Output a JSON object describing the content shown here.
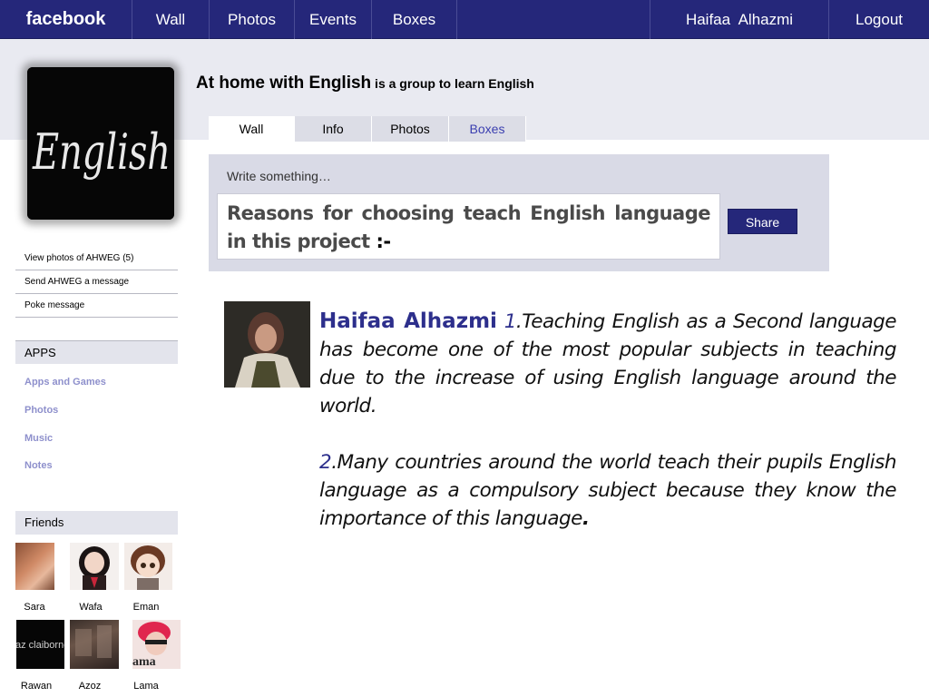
{
  "topbar": {
    "brand": "facebook",
    "nav": [
      "Wall",
      "Photos",
      "Events",
      "Boxes"
    ],
    "user": "Haifaa  Alhazmi",
    "logout": "Logout"
  },
  "group": {
    "title": "At home with English",
    "subtitle": " is a group to  learn English",
    "image_text": "English"
  },
  "tabs": [
    "Wall",
    "Info",
    "Photos",
    "Boxes"
  ],
  "composer": {
    "prompt": "Write something…",
    "text": "Reasons for choosing teach English language in this project ",
    "text_end": ":-",
    "share": "Share"
  },
  "sidebar": {
    "links": [
      "View photos of AHWEG (5)",
      "Send AHWEG a message",
      "Poke message"
    ],
    "apps_title": "APPS",
    "apps": [
      "Apps and Games",
      "Photos",
      "Music",
      "Notes"
    ],
    "friends_title": "Friends",
    "friends": [
      "Sara",
      "Wafa",
      "Eman",
      "Rawan",
      "Azoz",
      "Lama"
    ],
    "friend_pic_text_rawan": "az claiborne",
    "friend_pic_text_lama": "ama"
  },
  "post": {
    "author": "Haifaa  Alhazmi",
    "p1_num": "1",
    "p1_text": ".Teaching English as a Second language has become one of the most popular subjects in teaching due to the increase of using English language around the world.",
    "p2_num": "2",
    "p2_text": ".Many countries around the world teach their pupils English language as a compulsory subject because they know the importance of this language",
    "p2_end": "."
  },
  "colors": {
    "topbar": "#25277a",
    "band": "#e9eaf1",
    "accent_text": "#2d2f8c",
    "app_link": "#8e90cc"
  }
}
